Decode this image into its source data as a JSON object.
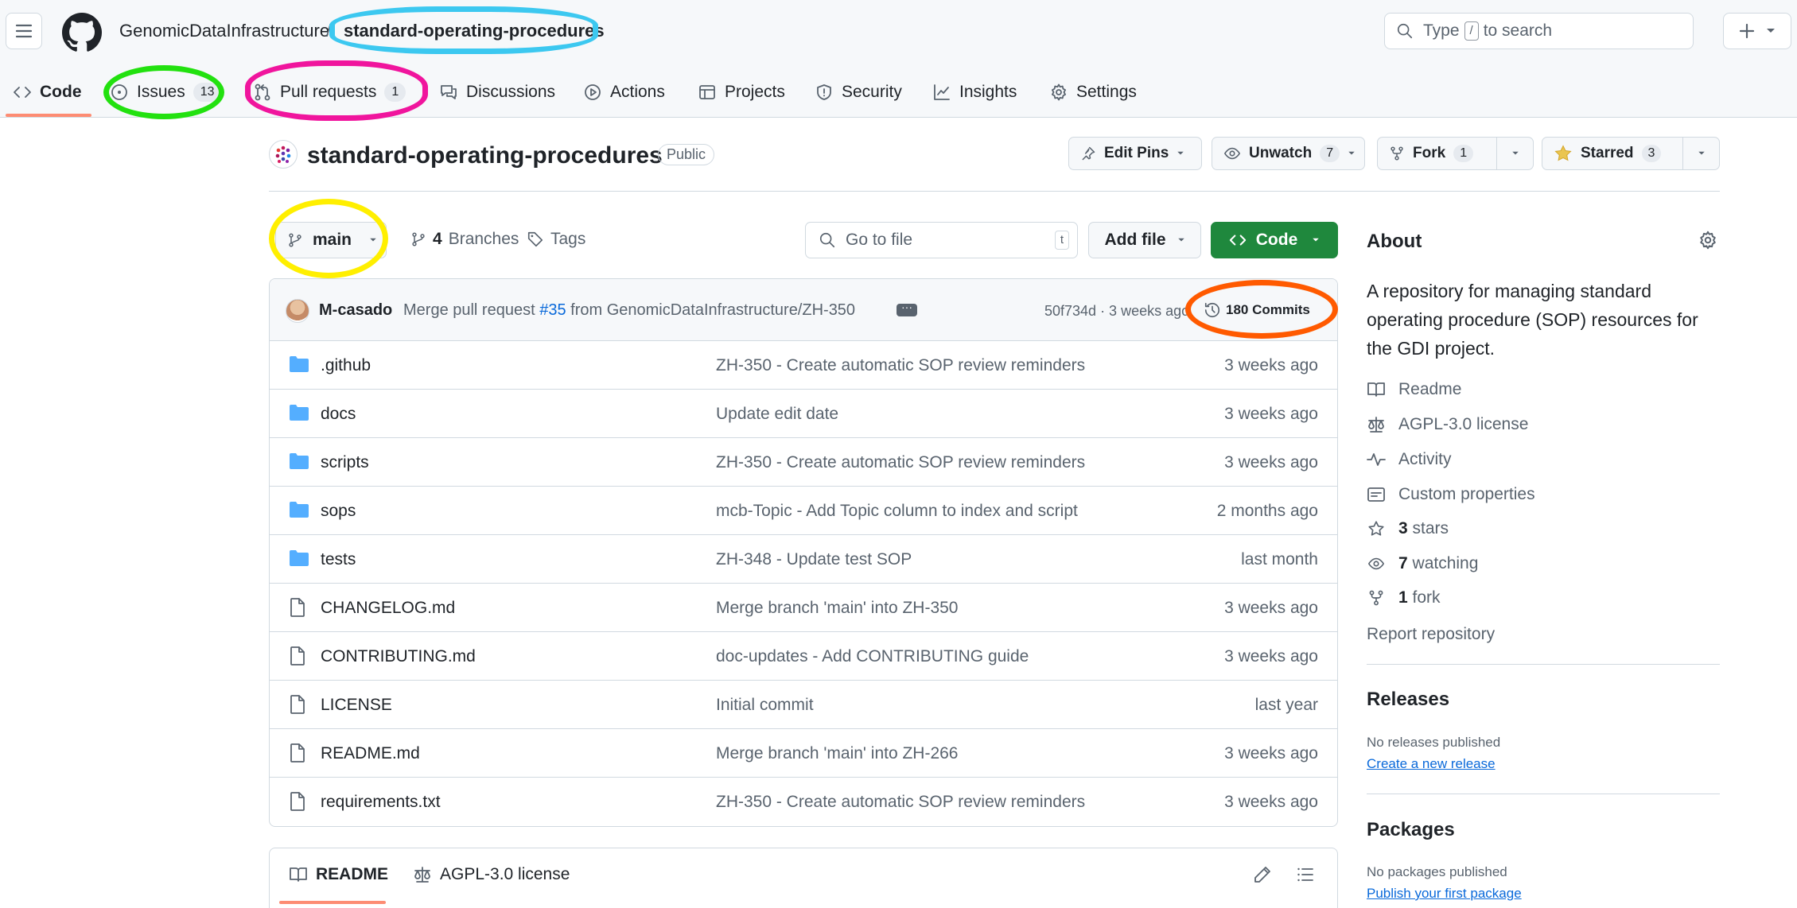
{
  "header": {
    "owner": "GenomicDataInfrastructure",
    "separator": "/",
    "repo": "standard-operating-procedures",
    "search_prefix": "Type",
    "search_key": "/",
    "search_suffix": "to search"
  },
  "tabs": [
    {
      "label": "Code",
      "icon": "code-icon"
    },
    {
      "label": "Issues",
      "count": "13",
      "icon": "issue-icon"
    },
    {
      "label": "Pull requests",
      "count": "1",
      "icon": "pull-request-icon"
    },
    {
      "label": "Discussions",
      "icon": "comment-icon"
    },
    {
      "label": "Actions",
      "icon": "play-icon"
    },
    {
      "label": "Projects",
      "icon": "table-icon"
    },
    {
      "label": "Security",
      "icon": "shield-icon"
    },
    {
      "label": "Insights",
      "icon": "graph-icon"
    },
    {
      "label": "Settings",
      "icon": "gear-icon"
    }
  ],
  "repo_header": {
    "title": "standard-operating-procedures",
    "visibility": "Public",
    "edit_pins": "Edit Pins",
    "unwatch": "Unwatch",
    "watch_count": "7",
    "fork": "Fork",
    "fork_count": "1",
    "starred": "Starred",
    "star_count": "3"
  },
  "toolbar": {
    "branch": "main",
    "branches_count": "4",
    "branches_label": "Branches",
    "tags_label": "Tags",
    "goto_placeholder": "Go to file",
    "goto_key": "t",
    "add_file": "Add file",
    "code": "Code"
  },
  "latest_commit": {
    "author": "M-casado",
    "message_prefix": "Merge pull request",
    "pr_link": "#35",
    "message_suffix": "from GenomicDataInfrastructure/ZH-350",
    "hash_time": "50f734d · 3 weeks ago",
    "commits": "180 Commits"
  },
  "files": [
    {
      "name": ".github",
      "type": "folder",
      "message": "ZH-350 - Create automatic SOP review reminders",
      "date": "3 weeks ago"
    },
    {
      "name": "docs",
      "type": "folder",
      "message": "Update edit date",
      "date": "3 weeks ago"
    },
    {
      "name": "scripts",
      "type": "folder",
      "message": "ZH-350 - Create automatic SOP review reminders",
      "date": "3 weeks ago"
    },
    {
      "name": "sops",
      "type": "folder",
      "message": "mcb-Topic - Add Topic column to index and script",
      "date": "2 months ago"
    },
    {
      "name": "tests",
      "type": "folder",
      "message": "ZH-348 - Update test SOP",
      "date": "last month"
    },
    {
      "name": "CHANGELOG.md",
      "type": "file",
      "message": "Merge branch 'main' into ZH-350",
      "date": "3 weeks ago"
    },
    {
      "name": "CONTRIBUTING.md",
      "type": "file",
      "message": "doc-updates - Add CONTRIBUTING guide",
      "date": "3 weeks ago"
    },
    {
      "name": "LICENSE",
      "type": "file",
      "message": "Initial commit",
      "date": "last year"
    },
    {
      "name": "README.md",
      "type": "file",
      "message": "Merge branch 'main' into ZH-266",
      "date": "3 weeks ago"
    },
    {
      "name": "requirements.txt",
      "type": "file",
      "message": "ZH-350 - Create automatic SOP review reminders",
      "date": "3 weeks ago"
    }
  ],
  "readme_tabs": {
    "readme": "README",
    "license": "AGPL-3.0 license"
  },
  "about": {
    "heading": "About",
    "description": "A repository for managing standard operating procedure (SOP) resources for the GDI project.",
    "readme": "Readme",
    "license": "AGPL-3.0 license",
    "activity": "Activity",
    "custom_properties": "Custom properties",
    "stars_count": "3",
    "stars_label": "stars",
    "watching_count": "7",
    "watching_label": "watching",
    "fork_count": "1",
    "fork_label": "fork",
    "report": "Report repository"
  },
  "releases": {
    "heading": "Releases",
    "empty": "No releases published",
    "create": "Create a new release"
  },
  "packages": {
    "heading": "Packages",
    "empty": "No packages published",
    "publish": "Publish your first package"
  },
  "colors": {
    "annotation_green": "#22e10f",
    "annotation_magenta": "#f0159d",
    "annotation_cyan": "#3cc8f0",
    "annotation_yellow": "#ffef00",
    "annotation_orange": "#ff5a00",
    "code_button": "#1f883d",
    "link": "#0969da",
    "folder": "#54aeff"
  }
}
